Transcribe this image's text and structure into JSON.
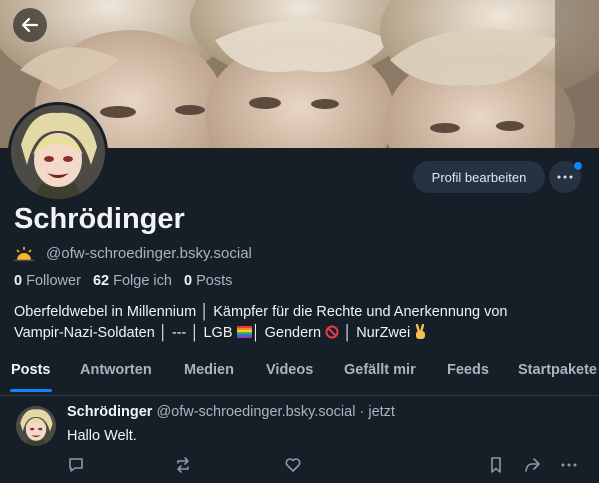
{
  "header": {
    "back_icon": "arrow-left-icon"
  },
  "profile": {
    "display_name": "Schrödinger",
    "handle_prefix_icon": "sunrise-emoji",
    "handle": "@ofw-schroedinger.bsky.social",
    "edit_profile_label": "Profil bearbeiten",
    "more_icon": "ellipsis-icon",
    "notification_dot_color": "#1083fe"
  },
  "stats": {
    "followers_count": "0",
    "followers_label": "Follower",
    "following_count": "62",
    "following_label": "Folge ich",
    "posts_count": "0",
    "posts_label": "Posts"
  },
  "bio": {
    "line1": "Oberfeldwebel in Millennium │ Kämpfer für die Rechte und Anerkennung von",
    "line2_a": "Vampir-Nazi-Soldaten │ --- │ LGB ",
    "line2_b": "│ Gendern ",
    "line2_c": " │ NurZwei ",
    "emoji_flag": "rainbow-flag-emoji",
    "emoji_prohibited": "prohibited-emoji",
    "emoji_victory": "victory-hand-emoji"
  },
  "tabs": [
    {
      "label": "Posts",
      "active": true
    },
    {
      "label": "Antworten",
      "active": false
    },
    {
      "label": "Medien",
      "active": false
    },
    {
      "label": "Videos",
      "active": false
    },
    {
      "label": "Gefällt mir",
      "active": false
    },
    {
      "label": "Feeds",
      "active": false
    },
    {
      "label": "Startpakete",
      "active": false
    }
  ],
  "post": {
    "author": "Schrödinger",
    "handle": "@ofw-schroedinger.bsky.social",
    "separator": " · ",
    "time": "jetzt",
    "text": "Hallo Welt.",
    "actions": [
      "reply-icon",
      "repost-icon",
      "like-icon",
      "bookmark-icon",
      "share-icon",
      "more-horizontal-icon"
    ]
  },
  "colors": {
    "background": "#161e27",
    "accent": "#1083fe",
    "text_primary": "#f1f3f5",
    "text_secondary": "#aab4bf",
    "button_bg": "#263242"
  }
}
